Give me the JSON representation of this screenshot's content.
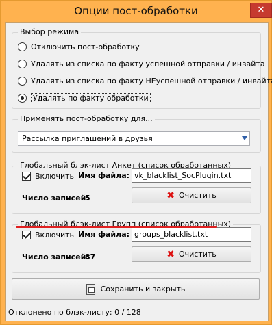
{
  "window": {
    "title": "Опции пост-обработки",
    "close_glyph": "✕"
  },
  "mode_group": {
    "legend": "Выбор режима",
    "options": [
      {
        "label": "Отключить пост-обработку",
        "selected": false
      },
      {
        "label": "Удалять из списка по факту успешной отправки / инвайта",
        "selected": false
      },
      {
        "label": "Удалять из списка по факту НЕуспешной отправки / инвайта",
        "selected": false
      },
      {
        "label": "Удалять по факту обработки",
        "selected": true
      }
    ]
  },
  "apply_group": {
    "legend": "Применять пост-обработку для...",
    "selected_value": "Рассылка приглашений в друзья"
  },
  "blacklist_profiles": {
    "legend": "Глобальный блэк-лист Анкет (список обработанных)",
    "enable_label": "Включить",
    "enabled": true,
    "file_label": "Имя файла:",
    "file_value": "vk_blacklist_SocPlugin.txt",
    "count_label": "Число записей:",
    "count_value": "5",
    "clear_label": "Очистить"
  },
  "blacklist_groups": {
    "legend": "Глобальный блэк-лист Групп (список обработанных)",
    "enable_label": "Включить",
    "enabled": true,
    "file_label": "Имя файла:",
    "file_value": "groups_blacklist.txt",
    "count_label": "Число записей:",
    "count_value": "87",
    "clear_label": "Очистить"
  },
  "save_button": {
    "label": "Сохранить и закрыть",
    "icon": "save-icon"
  },
  "status_bar": {
    "text": "Отклонено по блэк-листу: 0 / 128"
  },
  "colors": {
    "title_bar": "#ffb24f",
    "annotation_underline": "#e02020",
    "clear_icon": "#dd1111"
  }
}
